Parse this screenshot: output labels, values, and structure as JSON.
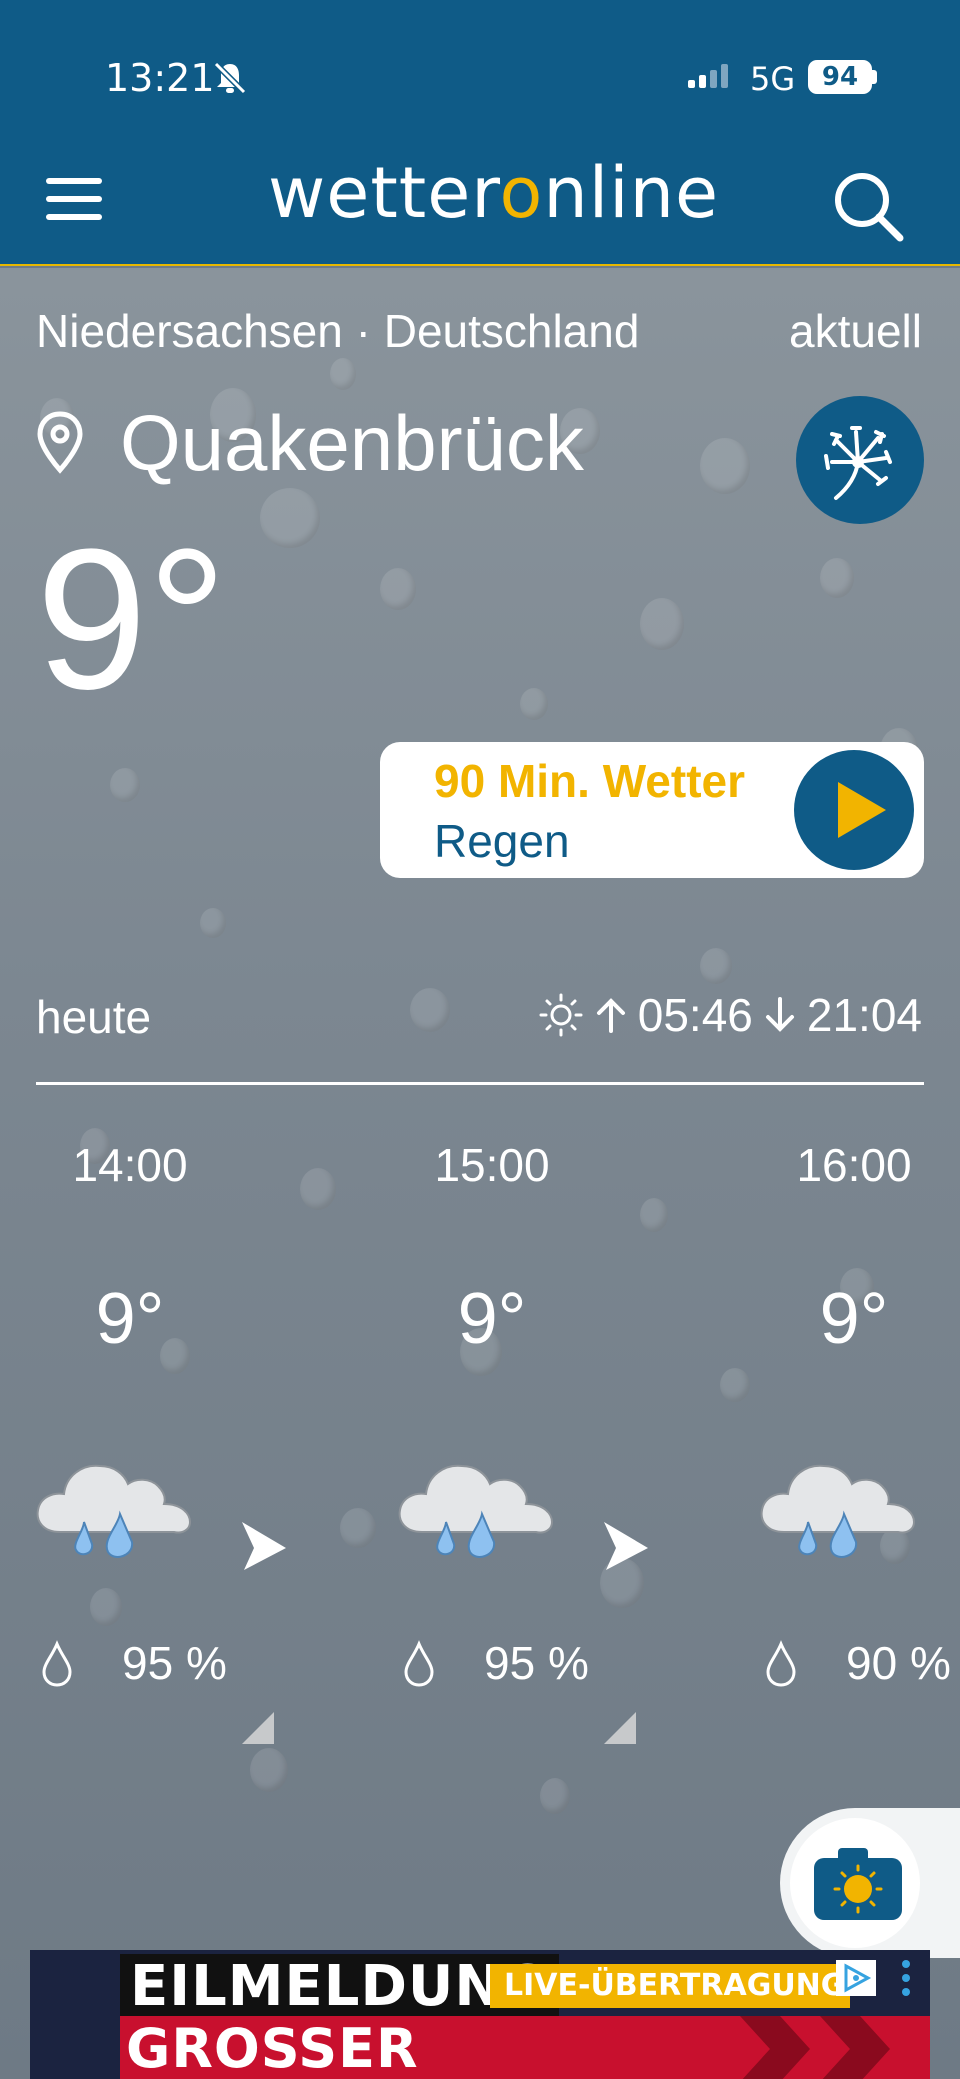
{
  "status_bar": {
    "time": "13:21",
    "network": "5G",
    "battery": "94"
  },
  "header": {
    "logo_before": "wetter",
    "logo_o": "o",
    "logo_after": "nline"
  },
  "location": {
    "region": "Niedersachsen · Deutschland",
    "mode": "aktuell",
    "city": "Quakenbrück"
  },
  "current": {
    "temperature": "9°"
  },
  "nowcast": {
    "title": "90 Min. Wetter",
    "subtitle": "Regen"
  },
  "today": {
    "label": "heute",
    "sunrise": "05:46",
    "sunset": "21:04"
  },
  "hourly": [
    {
      "time": "14:00",
      "temp": "9°",
      "precip": "95 %",
      "icon": "rain-cloud-icon"
    },
    {
      "time": "15:00",
      "temp": "9°",
      "precip": "95 %",
      "icon": "rain-cloud-icon"
    },
    {
      "time": "16:00",
      "temp": "9°",
      "precip": "90 %",
      "icon": "rain-cloud-icon"
    }
  ],
  "ad": {
    "headline": "EILMELDUNG",
    "tag": "LIVE-ÜBERTRAGUNG",
    "subline": "GROSSER SKANDAL"
  },
  "colors": {
    "brand_blue": "#0f5b87",
    "accent_yellow": "#f2b400"
  }
}
